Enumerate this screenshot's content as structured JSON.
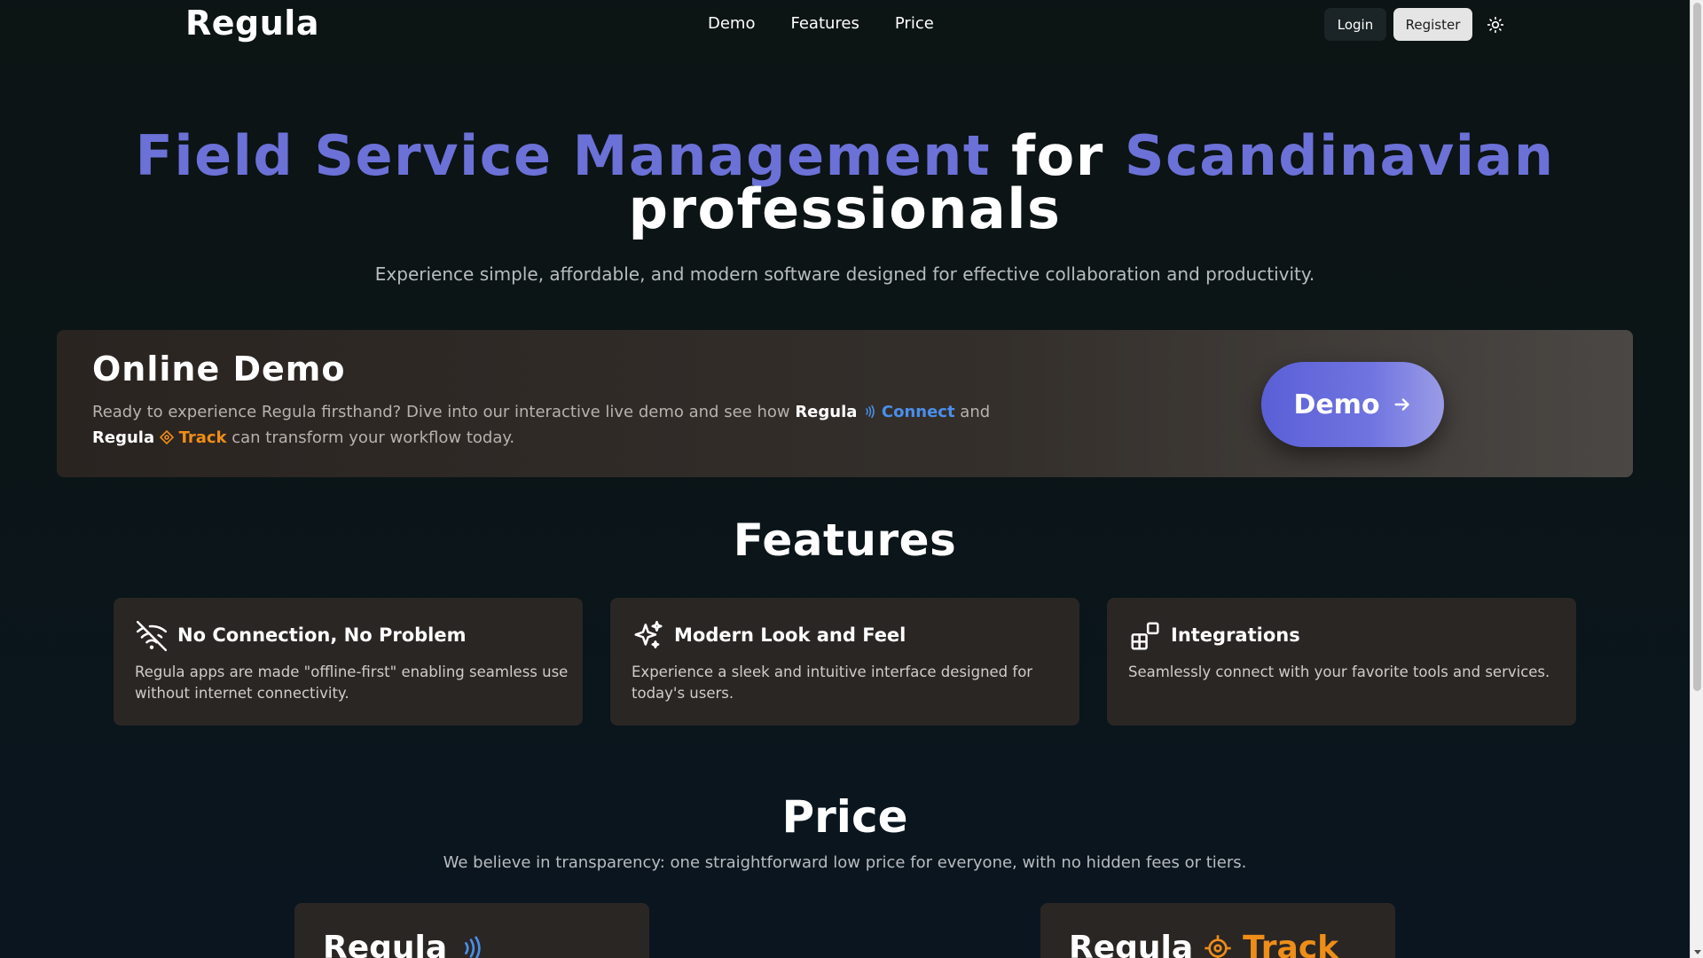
{
  "nav": {
    "logo": "Regula",
    "links": [
      "Demo",
      "Features",
      "Price"
    ],
    "login_label": "Login",
    "register_label": "Register"
  },
  "hero": {
    "title_part1": "Field Service Management",
    "title_part2": " for ",
    "title_part3": "Scandinavian",
    "title_part4": "professionals",
    "subtitle": "Experience simple, affordable, and modern software designed for effective collaboration and productivity."
  },
  "demo": {
    "title": "Online Demo",
    "text_prefix": "Ready to experience Regula firsthand? Dive into our interactive live demo and see how ",
    "brand": "Regula",
    "connect": "Connect",
    "and": " and ",
    "track": "Track",
    "text_suffix": " can transform your workflow today.",
    "button_label": "Demo"
  },
  "features": {
    "heading": "Features",
    "items": [
      {
        "icon": "wifi-off-icon",
        "title": "No Connection, No Problem",
        "description": "Regula apps are made \"offline-first\" enabling seamless use without internet connectivity."
      },
      {
        "icon": "sparkles-icon",
        "title": "Modern Look and Feel",
        "description": "Experience a sleek and intuitive interface designed for today's users."
      },
      {
        "icon": "integrations-icon",
        "title": "Integrations",
        "description": "Seamlessly connect with your favorite tools and services."
      }
    ]
  },
  "price": {
    "heading": "Price",
    "subtitle": "We believe in transparency: one straightforward low price for everyone, with no hidden fees or tiers.",
    "cards": [
      {
        "brand": "Regula",
        "product": ""
      },
      {
        "brand": "Regula",
        "product": "Track"
      }
    ]
  },
  "colors": {
    "accent": "#6b71d6",
    "connect": "#4a8fea",
    "track": "#ee8d18"
  }
}
